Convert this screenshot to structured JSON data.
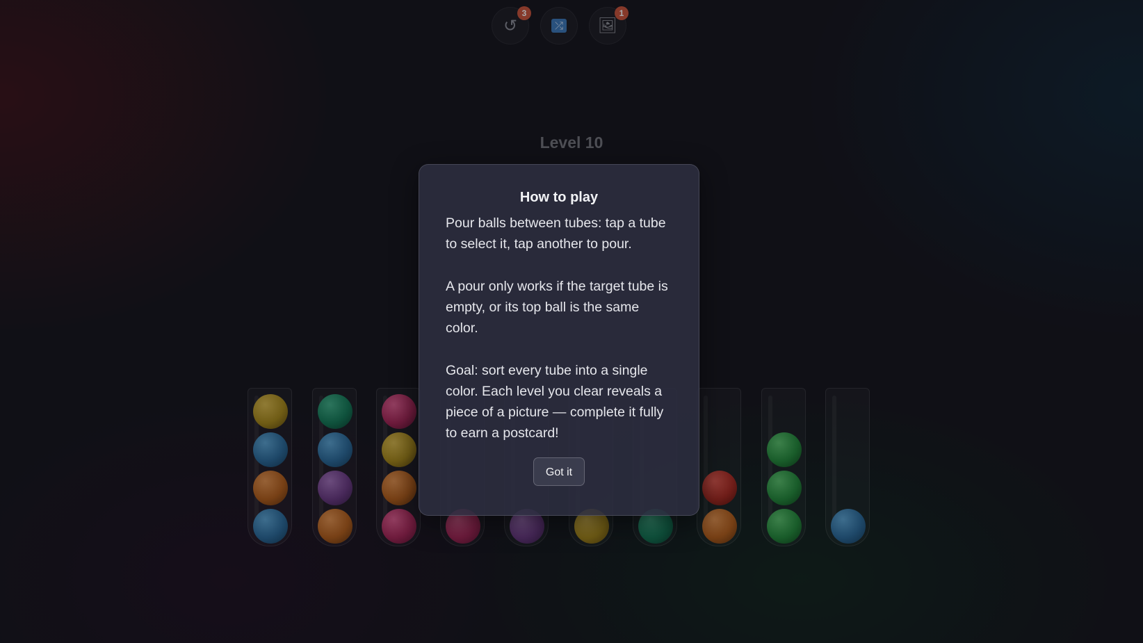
{
  "toolbar": {
    "undo": {
      "icon": "undo-icon",
      "glyph": "↺",
      "badge": "3"
    },
    "shuffle": {
      "icon": "shuffle-icon",
      "glyph": "⤮"
    },
    "picture": {
      "icon": "picture-icon",
      "glyph": "🖼",
      "badge": "1"
    }
  },
  "level": {
    "title": "Level 10"
  },
  "tubes": [
    {
      "balls_bottom_to_top": [
        "blue",
        "orange",
        "blue",
        "yellow"
      ]
    },
    {
      "balls_bottom_to_top": [
        "orange",
        "purple",
        "blue",
        "teal"
      ]
    },
    {
      "balls_bottom_to_top": [
        "pink",
        "orange",
        "yellow",
        "pink"
      ]
    },
    {
      "balls_bottom_to_top": [
        "pink"
      ]
    },
    {
      "balls_bottom_to_top": [
        "purple"
      ]
    },
    {
      "balls_bottom_to_top": [
        "yellow"
      ]
    },
    {
      "balls_bottom_to_top": [
        "teal"
      ]
    },
    {
      "balls_bottom_to_top": [
        "orange",
        "red"
      ]
    },
    {
      "balls_bottom_to_top": [
        "green",
        "green",
        "green"
      ]
    },
    {
      "balls_bottom_to_top": [
        "blue"
      ]
    }
  ],
  "modal": {
    "title": "How to play",
    "paragraphs": [
      "Pour balls between tubes: tap a tube to select it, tap another to pour.",
      "A pour only works if the target tube is empty, or its top ball is the same color.",
      "Goal: sort every tube into a single color. Each level you clear reveals a piece of a picture — complete it fully to earn a postcard!"
    ],
    "button_label": "Got it"
  },
  "colors": {
    "badge": "#c9533a",
    "yellow": "#a88a1a",
    "blue": "#2a6a99",
    "orange": "#b25e1a",
    "teal": "#137a56",
    "purple": "#6a3a82",
    "pink": "#a52656",
    "red": "#a82a20",
    "green": "#238a3a"
  }
}
